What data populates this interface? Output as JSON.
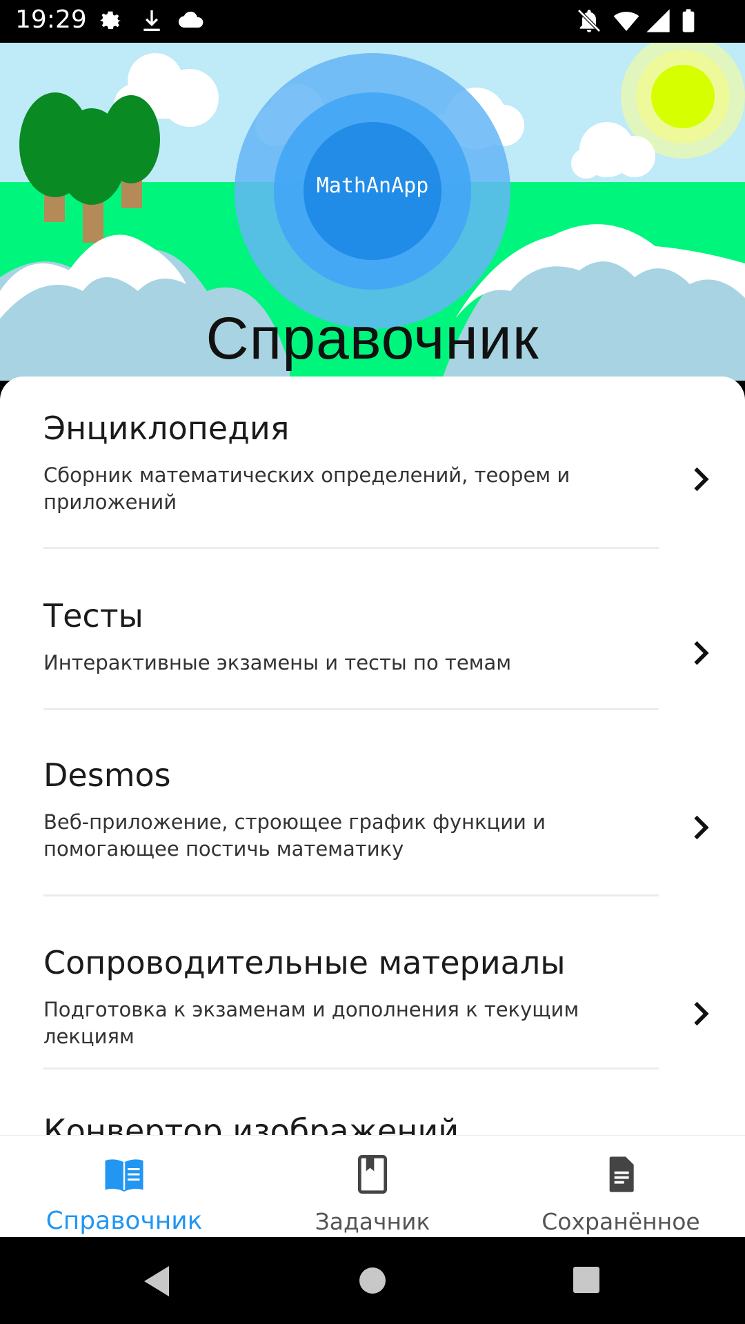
{
  "status_bar": {
    "time": "19:29",
    "icons_left": [
      "gear-icon",
      "download-icon",
      "cloud-icon"
    ],
    "icons_right": [
      "notifications-off-icon",
      "wifi-icon",
      "signal-icon",
      "battery-icon"
    ]
  },
  "hero": {
    "logo_text": "MathAnApp",
    "title": "Справочник"
  },
  "items": [
    {
      "title": "Энциклопедия",
      "desc": "Сборник математических определений, теорем и приложений"
    },
    {
      "title": "Тесты",
      "desc": "Интерактивные экзамены и тесты по темам"
    },
    {
      "title": "Desmos",
      "desc": "Веб-приложение, строющее график функции и помогающее постичь математику"
    },
    {
      "title": "Сопроводительные материалы",
      "desc": "Подготовка к экзаменам и дополнения к текущим лекциям"
    },
    {
      "title": "Конвертор изображений",
      "desc": ""
    }
  ],
  "bottom_nav": [
    {
      "label": "Справочник",
      "icon": "book-open-icon",
      "active": true
    },
    {
      "label": "Задачник",
      "icon": "bookmark-book-icon",
      "active": false
    },
    {
      "label": "Сохранённое",
      "icon": "document-icon",
      "active": false
    }
  ],
  "colors": {
    "accent": "#2196f3",
    "sky": "#bfeaf8",
    "grass": "#00f57d",
    "sun": "#d6ff00"
  }
}
